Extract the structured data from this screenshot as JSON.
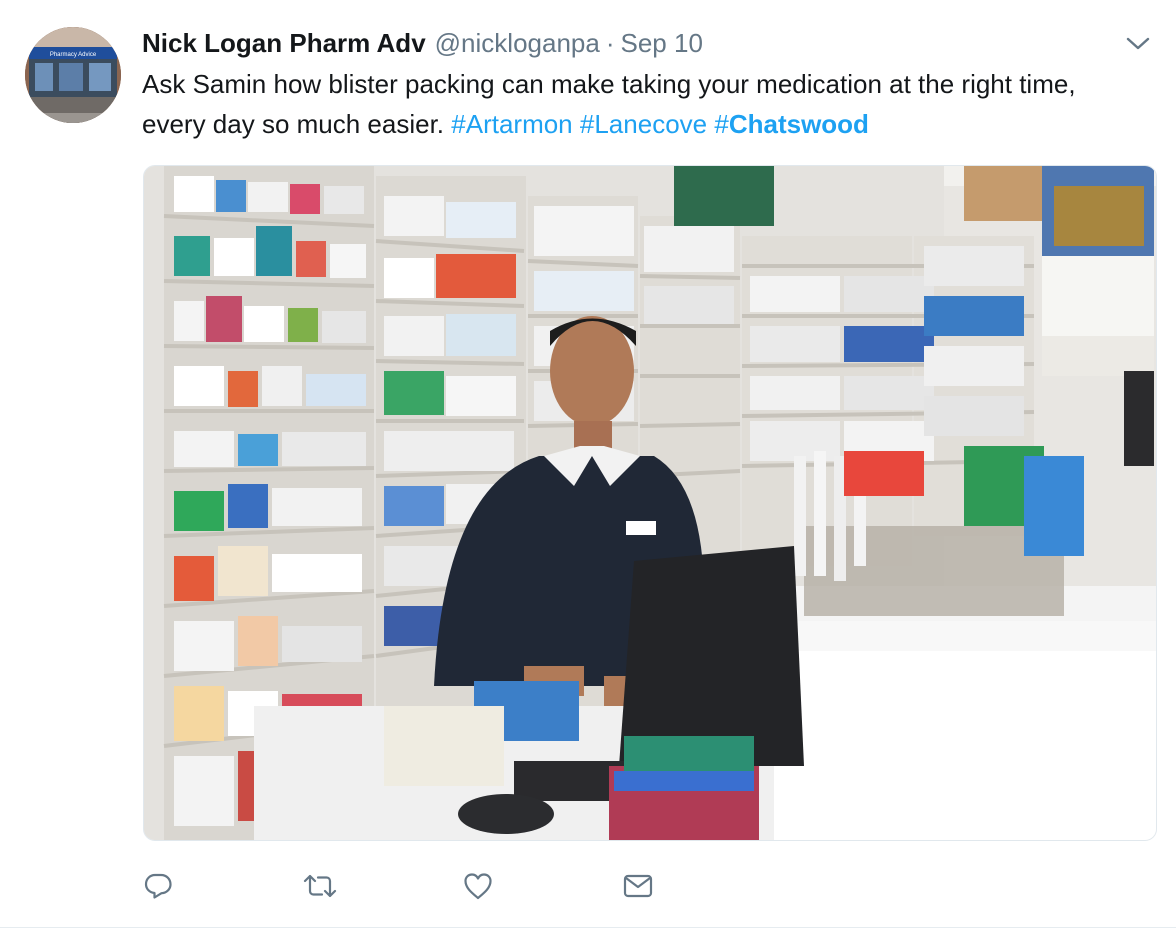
{
  "tweet": {
    "display_name": "Nick Logan Pharm Adv",
    "handle": "@nickloganpa",
    "separator": "·",
    "timestamp": "Sep 10",
    "text_main": "Ask Samin how blister packing can make taking your medication at the right time, every day so much easier. ",
    "hashtags": [
      "#Artarmon",
      "#Lanecove"
    ],
    "hashtag_emphasis_hash": "#",
    "hashtag_emphasis_word": "Chatswood",
    "avatar_sign_text": "Pharmacy Advice"
  },
  "actions": [
    {
      "name": "reply-icon"
    },
    {
      "name": "retweet-icon"
    },
    {
      "name": "like-icon"
    },
    {
      "name": "direct-message-icon"
    }
  ],
  "colors": {
    "accent": "#1da1f2",
    "secondary_text": "#657786",
    "icon": "#657786"
  }
}
